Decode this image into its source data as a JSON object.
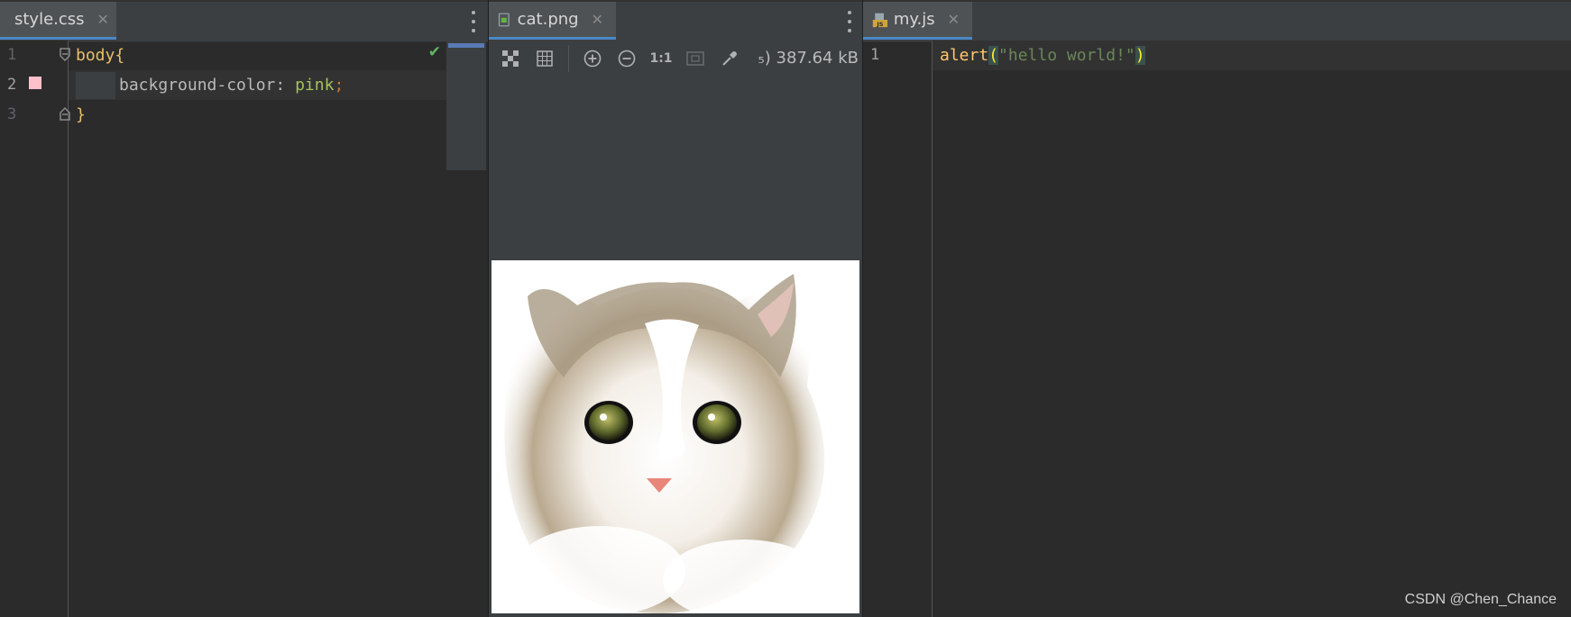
{
  "panes": {
    "css": {
      "tab": {
        "filename": "style.css",
        "icon": "css-file-icon"
      },
      "lines": [
        {
          "number": "1",
          "selector": "body",
          "brace": "{"
        },
        {
          "number": "2",
          "property": "background-color",
          "colon": ":",
          "value": "pink",
          "semicolon": ";"
        },
        {
          "number": "3",
          "brace": "}"
        }
      ],
      "swatch_color": "#ffc0cb"
    },
    "image": {
      "tab": {
        "filename": "cat.png",
        "icon": "image-file-icon"
      },
      "toolbar": {
        "actual_size_label": "1:1",
        "file_size": "387.64 kB",
        "file_size_prefix": "₅)"
      }
    },
    "js": {
      "tab": {
        "filename": "my.js",
        "icon": "js-file-icon"
      },
      "lines": [
        {
          "number": "1",
          "function": "alert",
          "open_paren": "(",
          "string": "\"hello world!\"",
          "close_paren": ")"
        }
      ]
    }
  },
  "watermark": "CSDN @Chen_Chance",
  "colors": {
    "tab_accent": "#4a88c7",
    "keyword": "#e8bf6a",
    "value": "#a5c25c",
    "string": "#6a8759",
    "function": "#ffc66d"
  }
}
